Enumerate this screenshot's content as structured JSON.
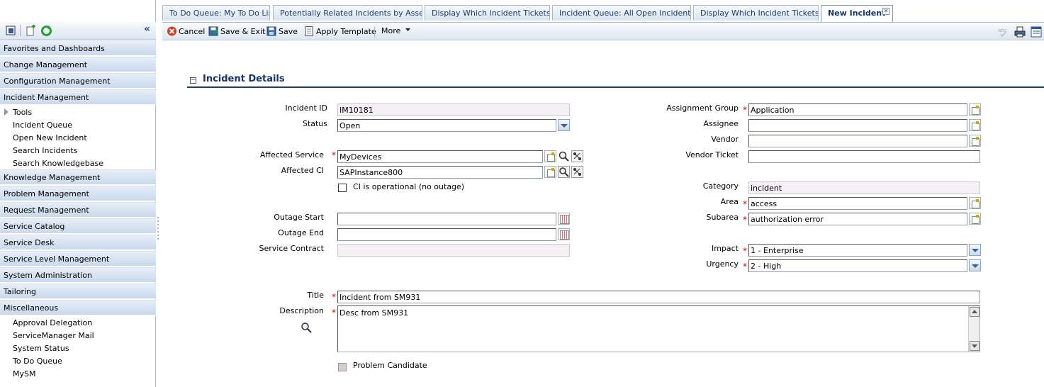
{
  "tabs": [
    {
      "label": "To Do Queue: My To Do List"
    },
    {
      "label": "Potentially Related Incidents by Asset"
    },
    {
      "label": "Display Which Incident Tickets?"
    },
    {
      "label": "Incident Queue: All Open Incidents"
    },
    {
      "label": "Display Which Incident Tickets?"
    },
    {
      "label": "New Incident"
    }
  ],
  "tab_close_glyph": "✕",
  "sidebar": {
    "collapse_glyph": "«",
    "sections": [
      {
        "label": "Favorites and Dashboards"
      },
      {
        "label": "Change Management"
      },
      {
        "label": "Configuration Management"
      },
      {
        "label": "Incident Management"
      },
      {
        "label": "Knowledge Management"
      },
      {
        "label": "Problem Management"
      },
      {
        "label": "Request Management"
      },
      {
        "label": "Service Catalog"
      },
      {
        "label": "Service Desk"
      },
      {
        "label": "Service Level Management"
      },
      {
        "label": "System Administration"
      },
      {
        "label": "Tailoring"
      },
      {
        "label": "Miscellaneous"
      }
    ],
    "incident_items": [
      {
        "label": "Tools"
      },
      {
        "label": "Incident Queue"
      },
      {
        "label": "Open New Incident"
      },
      {
        "label": "Search Incidents"
      },
      {
        "label": "Search Knowledgebase"
      }
    ],
    "misc_items": [
      {
        "label": "Approval Delegation"
      },
      {
        "label": "ServiceManager Mail"
      },
      {
        "label": "System Status"
      },
      {
        "label": "To Do Queue"
      },
      {
        "label": "MySM"
      }
    ]
  },
  "toolbar": {
    "cancel": "Cancel",
    "save_exit": "Save & Exit",
    "save": "Save",
    "apply_template": "Apply Template",
    "more": "More"
  },
  "section": {
    "toggle_glyph": "⊟",
    "title": "Incident Details"
  },
  "required_mark": "*",
  "form": {
    "incident_id": {
      "label": "Incident ID",
      "value": "IM10181"
    },
    "status": {
      "label": "Status",
      "value": "Open"
    },
    "affected_service": {
      "label": "Affected Service",
      "value": "MyDevices"
    },
    "affected_ci": {
      "label": "Affected CI",
      "value": "SAPInstance800"
    },
    "ci_operational": {
      "label": "CI is operational (no outage)"
    },
    "outage_start": {
      "label": "Outage Start",
      "value": ""
    },
    "outage_end": {
      "label": "Outage End",
      "value": ""
    },
    "service_contract": {
      "label": "Service Contract",
      "value": ""
    },
    "assignment_group": {
      "label": "Assignment Group",
      "value": "Application"
    },
    "assignee": {
      "label": "Assignee",
      "value": ""
    },
    "vendor": {
      "label": "Vendor",
      "value": ""
    },
    "vendor_ticket": {
      "label": "Vendor Ticket",
      "value": ""
    },
    "category": {
      "label": "Category",
      "value": "incident"
    },
    "area": {
      "label": "Area",
      "value": "access"
    },
    "subarea": {
      "label": "Subarea",
      "value": "authorization error"
    },
    "impact": {
      "label": "Impact",
      "value": "1 - Enterprise"
    },
    "urgency": {
      "label": "Urgency",
      "value": "2 - High"
    },
    "title": {
      "label": "Title",
      "value": "Incident from SM931"
    },
    "description": {
      "label": "Description",
      "value": "Desc from SM931"
    },
    "problem_candidate": {
      "label": "Problem Candidate"
    }
  }
}
